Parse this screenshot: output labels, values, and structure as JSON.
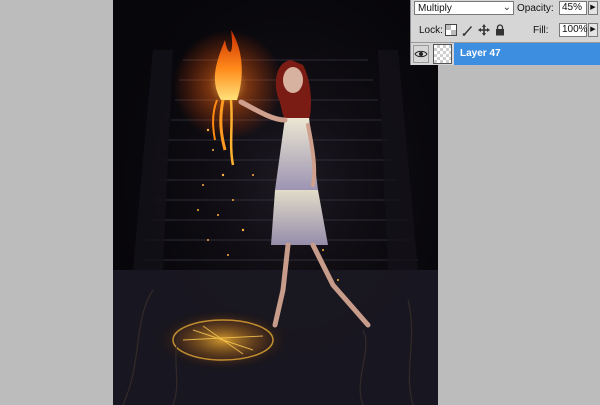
{
  "layers_panel": {
    "blend_mode": "Multiply",
    "opacity_label": "Opacity:",
    "opacity_value": "45%",
    "lock_label": "Lock:",
    "fill_label": "Fill:",
    "fill_value": "100%",
    "layer": {
      "name": "Layer 47",
      "visible": true,
      "selected": true
    },
    "lock_icons": [
      "lock-transparent-icon",
      "lock-pixels-icon",
      "lock-position-icon",
      "lock-all-icon"
    ]
  },
  "colors": {
    "workspace_bg": "#bcbcbc",
    "panel_bg": "#d6d6d6",
    "selected_layer": "#3d8ee0",
    "canvas_bg": "#07060a",
    "fire": "#ff8a1a"
  }
}
